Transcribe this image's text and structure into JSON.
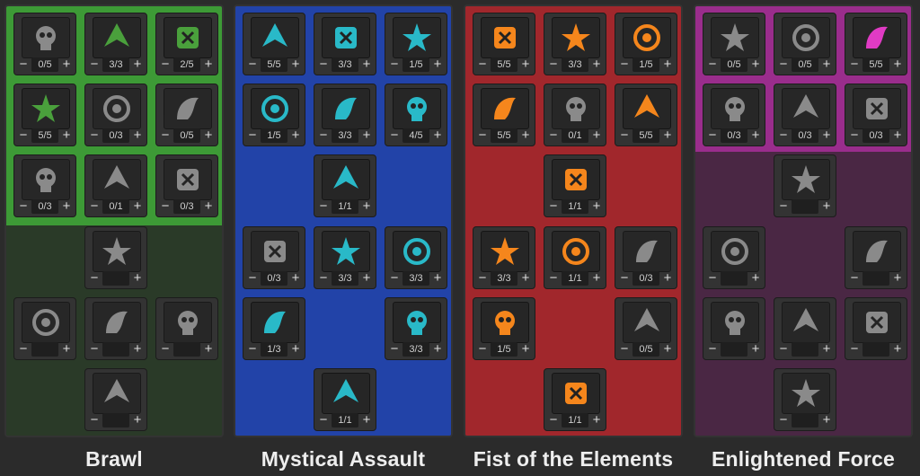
{
  "trees": [
    {
      "name": "Brawl",
      "accent": "#4aa03c",
      "bg_active": "#3d9a36",
      "bg_locked": "#2a3a28",
      "skills": [
        {
          "icon": "scroll-icon",
          "rank": "0/5",
          "glow": false
        },
        {
          "icon": "explosion-skull-icon",
          "rank": "3/3",
          "glow": true
        },
        {
          "icon": "rune-fist-icon",
          "rank": "2/5",
          "glow": true
        },
        {
          "icon": "octopus-icon",
          "rank": "5/5",
          "glow": true
        },
        {
          "icon": "helmet-skull-icon",
          "rank": "0/3",
          "glow": false
        },
        {
          "icon": "swirl-icon",
          "rank": "0/5",
          "glow": false
        },
        {
          "icon": "shield-fist-icon",
          "rank": "0/3",
          "glow": false
        },
        {
          "icon": "scythe-icon",
          "rank": "0/1",
          "glow": false
        },
        {
          "icon": "claw-icon",
          "rank": "0/3",
          "glow": false
        },
        {
          "icon": "spiked-ball-icon",
          "rank": "",
          "glow": false
        },
        {
          "icon": "beast-face-icon",
          "rank": "",
          "glow": false
        },
        {
          "icon": "warrior-icon",
          "rank": "",
          "glow": false
        },
        {
          "icon": "wing-burst-icon",
          "rank": "",
          "glow": false
        },
        {
          "icon": "bomb-fist-icon",
          "rank": "",
          "glow": false
        }
      ]
    },
    {
      "name": "Mystical Assault",
      "accent": "#29b9c8",
      "bg_active": "#2243a8",
      "bg_locked": "#2243a8",
      "skills": [
        {
          "icon": "skull-icon",
          "rank": "5/5",
          "glow": true
        },
        {
          "icon": "wings-icon",
          "rank": "3/3",
          "glow": true
        },
        {
          "icon": "skull-banner-icon",
          "rank": "1/5",
          "glow": true
        },
        {
          "icon": "spiral-shell-icon",
          "rank": "1/5",
          "glow": true
        },
        {
          "icon": "crosshair-icon",
          "rank": "3/3",
          "glow": true
        },
        {
          "icon": "spiked-fist-icon",
          "rank": "4/5",
          "glow": true
        },
        {
          "icon": "arrow-up-icon",
          "rank": "1/1",
          "glow": true
        },
        {
          "icon": "broken-chain-icon",
          "rank": "0/3",
          "glow": false
        },
        {
          "icon": "hand-skull-icon",
          "rank": "3/3",
          "glow": true
        },
        {
          "icon": "glowing-gauntlet-icon",
          "rank": "3/3",
          "glow": true
        },
        {
          "icon": "vortex-icon",
          "rank": "1/3",
          "glow": true
        },
        {
          "icon": "horned-skull-icon",
          "rank": "3/3",
          "glow": true
        },
        {
          "icon": "energy-orb-icon",
          "rank": "1/1",
          "glow": true
        }
      ]
    },
    {
      "name": "Fist of the Elements",
      "accent": "#f5861c",
      "bg_active": "#a1272c",
      "bg_locked": "#a1272c",
      "skills": [
        {
          "icon": "flame-hourglass-icon",
          "rank": "5/5",
          "glow": true
        },
        {
          "icon": "target-icon",
          "rank": "3/3",
          "glow": true
        },
        {
          "icon": "rune-stone-icon",
          "rank": "1/5",
          "glow": true
        },
        {
          "icon": "fire-mask-icon",
          "rank": "5/5",
          "glow": true
        },
        {
          "icon": "pointing-hand-icon",
          "rank": "0/1",
          "glow": false
        },
        {
          "icon": "skull-pile-icon",
          "rank": "5/5",
          "glow": true
        },
        {
          "icon": "fire-skull-icon",
          "rank": "1/1",
          "glow": true
        },
        {
          "icon": "lightning-icon",
          "rank": "3/3",
          "glow": true
        },
        {
          "icon": "fire-gauntlet-icon",
          "rank": "1/1",
          "glow": true
        },
        {
          "icon": "mushroom-skull-icon",
          "rank": "0/3",
          "glow": false
        },
        {
          "icon": "heart-hand-icon",
          "rank": "1/5",
          "glow": true
        },
        {
          "icon": "dragon-head-icon",
          "rank": "0/5",
          "glow": false
        },
        {
          "icon": "flame-pistol-icon",
          "rank": "1/1",
          "glow": true
        }
      ]
    },
    {
      "name": "Enlightened Force",
      "accent": "#e03bc4",
      "bg_active": "#9a2d8c",
      "bg_locked": "#4a2744",
      "skills": [
        {
          "icon": "shattered-shield-icon",
          "rank": "0/5",
          "glow": false
        },
        {
          "icon": "gorilla-icon",
          "rank": "0/5",
          "glow": false
        },
        {
          "icon": "pink-dragon-icon",
          "rank": "5/5",
          "glow": true
        },
        {
          "icon": "bottle-icon",
          "rank": "0/3",
          "glow": false
        },
        {
          "icon": "nest-icon",
          "rank": "0/3",
          "glow": false
        },
        {
          "icon": "fist-punch-icon",
          "rank": "0/3",
          "glow": false
        },
        {
          "icon": "gas-mask-icon",
          "rank": "",
          "glow": false
        },
        {
          "icon": "helmet-icon",
          "rank": "",
          "glow": false
        },
        {
          "icon": "face-portrait-icon",
          "rank": "",
          "glow": false
        },
        {
          "icon": "cannon-icon",
          "rank": "",
          "glow": false
        },
        {
          "icon": "shards-icon",
          "rank": "",
          "glow": false
        },
        {
          "icon": "burst-icon",
          "rank": "",
          "glow": false
        },
        {
          "icon": "leaping-figure-icon",
          "rank": "",
          "glow": false
        }
      ]
    }
  ],
  "controls": {
    "minus": "−",
    "plus": "+"
  }
}
